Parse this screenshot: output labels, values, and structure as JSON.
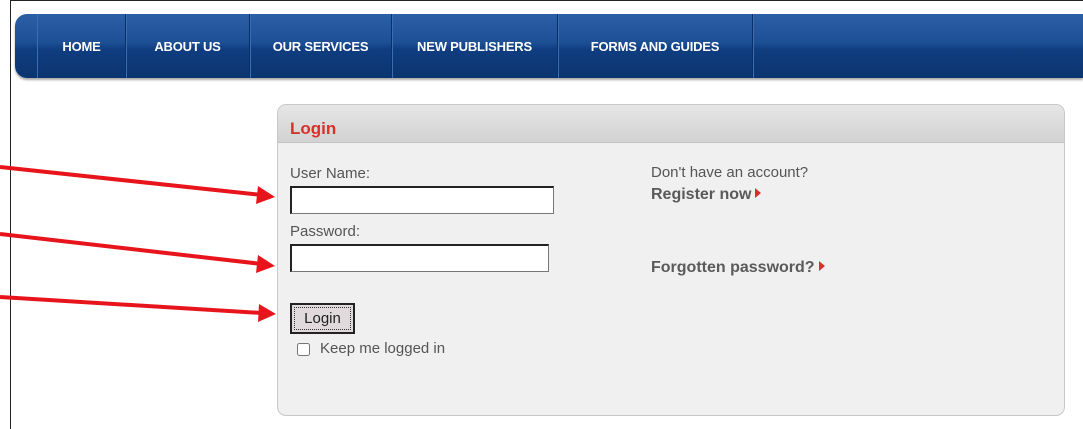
{
  "nav": {
    "items": [
      {
        "label": "HOME"
      },
      {
        "label": "ABOUT US"
      },
      {
        "label": "OUR SERVICES"
      },
      {
        "label": "NEW PUBLISHERS"
      },
      {
        "label": "FORMS AND GUIDES"
      }
    ]
  },
  "login": {
    "title": "Login",
    "username_label": "User Name:",
    "username_value": "",
    "password_label": "Password:",
    "password_value": "",
    "button_label": "Login",
    "remember_label": "Keep me logged in",
    "remember_checked": false
  },
  "side": {
    "no_account_text": "Don't have an account?",
    "register_label": "Register now",
    "forgot_label": "Forgotten password?"
  },
  "colors": {
    "nav_blue": "#0f3d80",
    "title_red": "#d8312b",
    "annotation_red": "#e8141c"
  },
  "icons": [
    "red-triangle-arrow-icon",
    "annotation-arrow-icon"
  ]
}
